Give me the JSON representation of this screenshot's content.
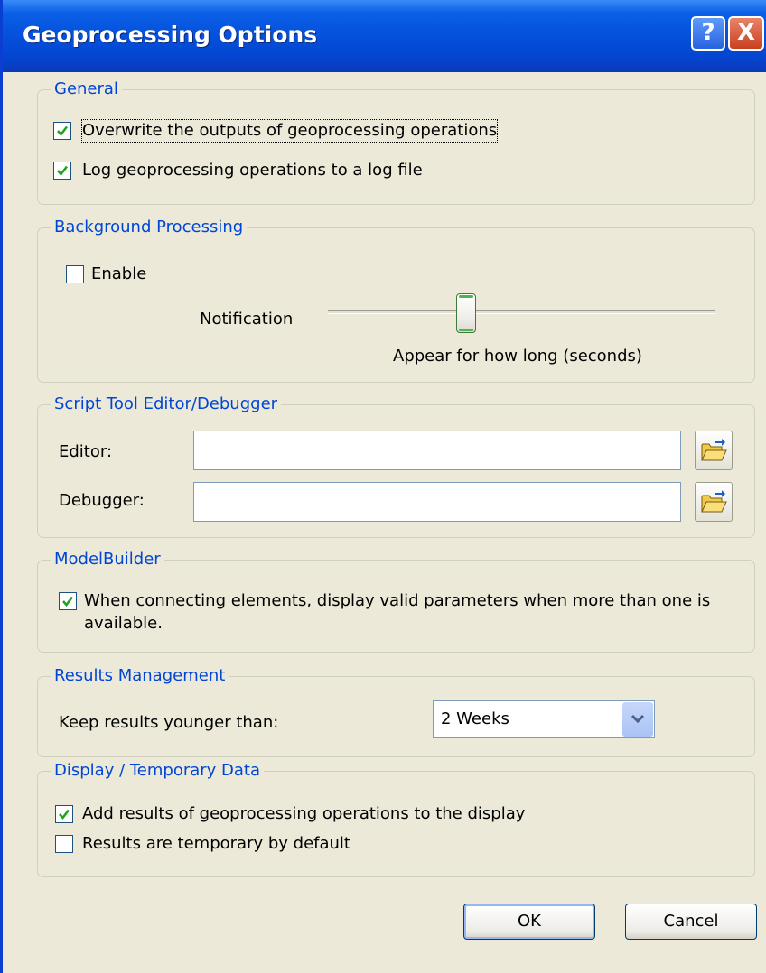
{
  "window": {
    "title": "Geoprocessing Options",
    "help_glyph": "?",
    "close_glyph": "X"
  },
  "general": {
    "legend": "General",
    "overwrite": {
      "label": "Overwrite the outputs of geoprocessing operations",
      "checked": true
    },
    "log": {
      "label": "Log geoprocessing operations to a log file",
      "checked": true
    }
  },
  "background": {
    "legend": "Background Processing",
    "enable": {
      "label": "Enable",
      "checked": false
    },
    "notification_label": "Notification",
    "slider_caption": "Appear for how long (seconds)"
  },
  "script": {
    "legend": "Script Tool Editor/Debugger",
    "editor_label": "Editor:",
    "editor_value": "",
    "debugger_label": "Debugger:",
    "debugger_value": ""
  },
  "modelbuilder": {
    "legend": "ModelBuilder",
    "display_params": {
      "label_line1": "When connecting elements, display valid parameters when more than one is",
      "label_line2": "available.",
      "checked": true
    }
  },
  "results": {
    "legend": "Results Management",
    "keep_label": "Keep results younger than:",
    "keep_value": "2 Weeks"
  },
  "display": {
    "legend": "Display / Temporary Data",
    "add_results": {
      "label": "Add results of geoprocessing operations to the display",
      "checked": true
    },
    "temporary": {
      "label": "Results are temporary by default",
      "checked": false
    }
  },
  "buttons": {
    "ok": "OK",
    "cancel": "Cancel"
  },
  "colors": {
    "titlebar": "#0550dc",
    "legend_text": "#0046d5",
    "dialog_bg": "#ece9d8",
    "check": "#21a121"
  }
}
